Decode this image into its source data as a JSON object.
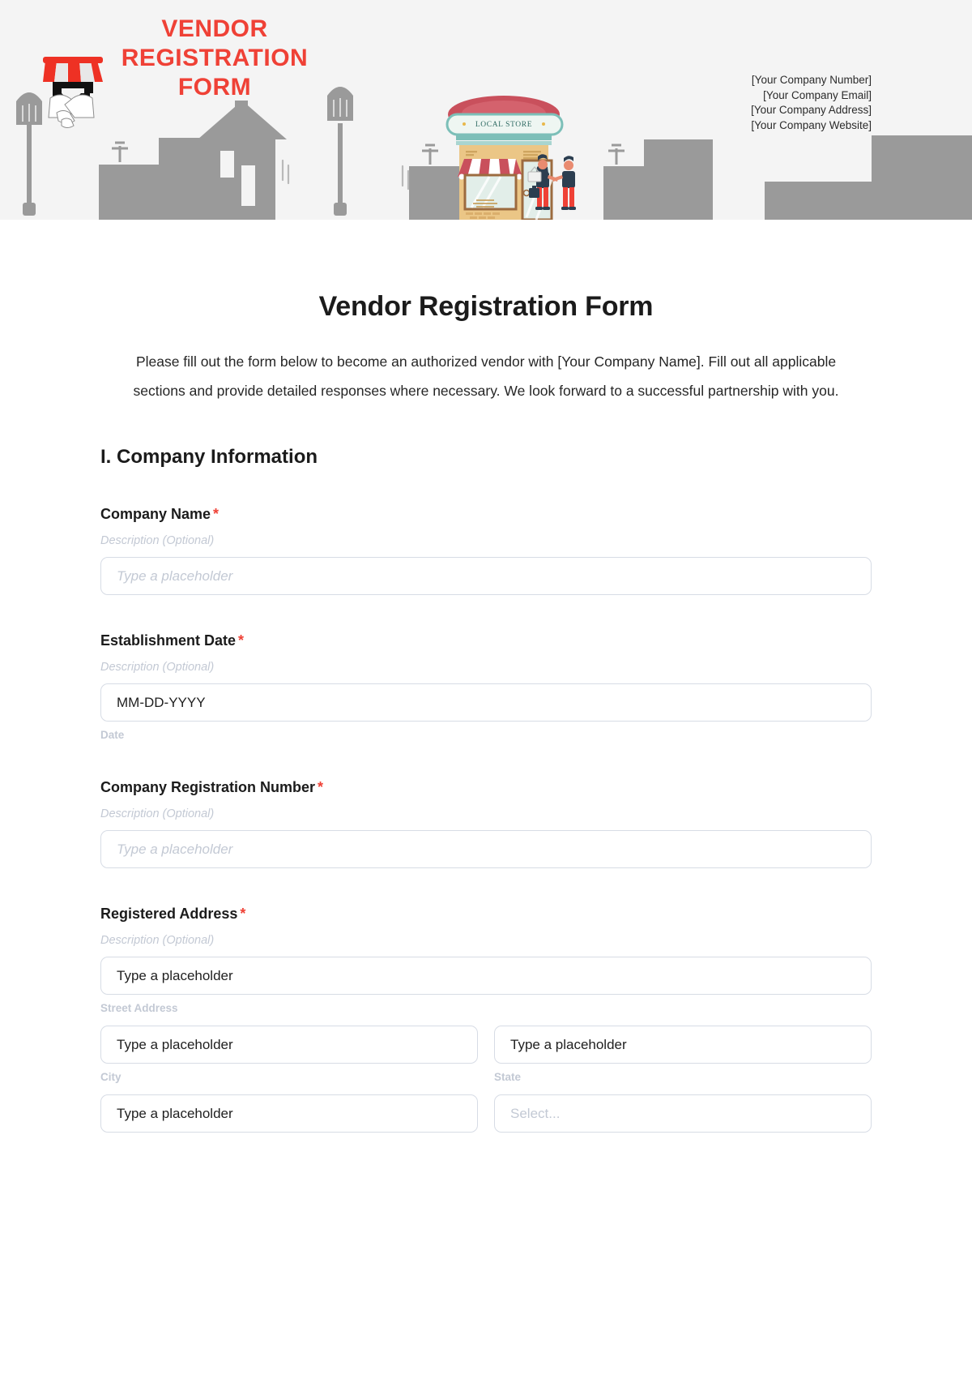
{
  "banner": {
    "brand_title": "VENDOR REGISTRATION FORM",
    "logo_icon": "handshake-storefront-icon",
    "contact_lines": [
      "[Your Company Number]",
      "[Your Company Email]",
      "[Your Company Address]",
      "[Your Company Website]"
    ],
    "store_sign": "LOCAL STORE",
    "colors": {
      "brand_red": "#ef4136",
      "banner_bg": "#f4f4f4",
      "silhouette": "#999999",
      "store_body": "#edc98a",
      "store_teal": "#7cbfb8",
      "store_red": "#c9505c"
    }
  },
  "form": {
    "title": "Vendor Registration Form",
    "intro": "Please fill out the form below to become an authorized vendor with [Your Company Name]. Fill out all applicable sections and provide detailed responses where necessary. We look forward to a successful partnership with you.",
    "sections": [
      {
        "heading": "I. Company Information",
        "fields": [
          {
            "label": "Company Name",
            "required_marker": "*",
            "description": "Description (Optional)",
            "value": "Type a placeholder"
          },
          {
            "label": "Establishment Date",
            "required_marker": "*",
            "description": "Description (Optional)",
            "value": "MM-DD-YYYY",
            "sub_label": "Date"
          },
          {
            "label": "Company Registration Number",
            "required_marker": "*",
            "description": "Description (Optional)",
            "value": "Type a placeholder"
          },
          {
            "label": "Registered Address",
            "required_marker": "*",
            "description": "Description (Optional)",
            "street": {
              "value": "Type a placeholder",
              "sub_label": "Street Address"
            },
            "city": {
              "value": "Type a placeholder",
              "sub_label": "City"
            },
            "state": {
              "value": "Type a placeholder",
              "sub_label": "State"
            },
            "zip": {
              "value": "Type a placeholder"
            },
            "country": {
              "value": "Select..."
            }
          }
        ]
      }
    ]
  }
}
